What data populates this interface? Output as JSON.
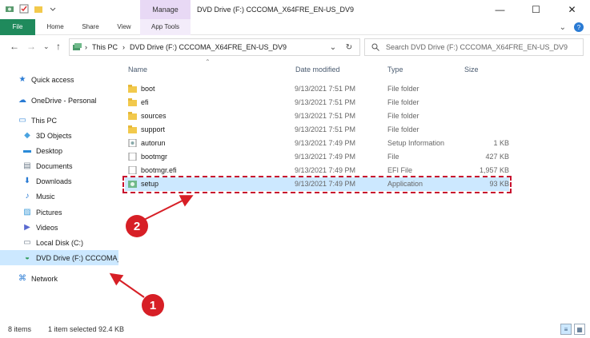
{
  "window": {
    "title": "DVD Drive (F:) CCCOMA_X64FRE_EN-US_DV9",
    "contextual_group": "Manage",
    "controls": {
      "minimize": "—",
      "maximize": "☐",
      "close": "✕"
    }
  },
  "ribbon": {
    "tabs": [
      "File",
      "Home",
      "Share",
      "View",
      "App Tools"
    ],
    "collapse_icon": "⌄",
    "help_icon": "?"
  },
  "address": {
    "breadcrumb": [
      "This PC",
      "DVD Drive (F:) CCCOMA_X64FRE_EN-US_DV9"
    ],
    "separator": "›",
    "dropdown_icon": "⌄",
    "refresh_icon": "↻",
    "search_placeholder": "Search DVD Drive (F:) CCCOMA_X64FRE_EN-US_DV9"
  },
  "navigation": {
    "back": "←",
    "forward": "→",
    "recent": "⌄",
    "up": "↑"
  },
  "sidebar": {
    "items": [
      {
        "label": "Quick access",
        "icon": "star-icon",
        "glyph": "★",
        "color": "#2a7bd4"
      },
      {
        "label": "OneDrive - Personal",
        "icon": "cloud-icon",
        "glyph": "☁",
        "color": "#2a7bd4"
      },
      {
        "label": "This PC",
        "icon": "computer-icon",
        "glyph": "▭",
        "color": "#3a8ad8"
      },
      {
        "label": "3D Objects",
        "icon": "cube-icon",
        "glyph": "◆",
        "color": "#4aa3e0"
      },
      {
        "label": "Desktop",
        "icon": "desktop-icon",
        "glyph": "▬",
        "color": "#2a8ad8"
      },
      {
        "label": "Documents",
        "icon": "documents-icon",
        "glyph": "▤",
        "color": "#6f7d8c"
      },
      {
        "label": "Downloads",
        "icon": "download-icon",
        "glyph": "⬇",
        "color": "#2a7bd4"
      },
      {
        "label": "Music",
        "icon": "music-icon",
        "glyph": "♪",
        "color": "#2a7bd4"
      },
      {
        "label": "Pictures",
        "icon": "pictures-icon",
        "glyph": "▨",
        "color": "#3a9ad8"
      },
      {
        "label": "Videos",
        "icon": "videos-icon",
        "glyph": "▶",
        "color": "#5a6ad0"
      },
      {
        "label": "Local Disk (C:)",
        "icon": "disk-icon",
        "glyph": "▭",
        "color": "#6c7a89"
      },
      {
        "label": "DVD Drive (F:) CCCOMA_X64FRE_EN-US_DV9",
        "icon": "dvd-icon",
        "glyph": "◒",
        "color": "#2f9b5a"
      },
      {
        "label": "Network",
        "icon": "network-icon",
        "glyph": "⌘",
        "color": "#2a7bd4"
      }
    ]
  },
  "columns": {
    "name": "Name",
    "date": "Date modified",
    "type": "Type",
    "size": "Size",
    "sort_arrow": "⌃"
  },
  "files": [
    {
      "name": "boot",
      "date": "9/13/2021 7:51 PM",
      "type": "File folder",
      "size": "",
      "icon": "folder-icon"
    },
    {
      "name": "efi",
      "date": "9/13/2021 7:51 PM",
      "type": "File folder",
      "size": "",
      "icon": "folder-icon"
    },
    {
      "name": "sources",
      "date": "9/13/2021 7:51 PM",
      "type": "File folder",
      "size": "",
      "icon": "folder-icon"
    },
    {
      "name": "support",
      "date": "9/13/2021 7:51 PM",
      "type": "File folder",
      "size": "",
      "icon": "folder-icon"
    },
    {
      "name": "autorun",
      "date": "9/13/2021 7:49 PM",
      "type": "Setup Information",
      "size": "1 KB",
      "icon": "setup-info-icon"
    },
    {
      "name": "bootmgr",
      "date": "9/13/2021 7:49 PM",
      "type": "File",
      "size": "427 KB",
      "icon": "file-icon"
    },
    {
      "name": "bootmgr.efi",
      "date": "9/13/2021 7:49 PM",
      "type": "EFI File",
      "size": "1,957 KB",
      "icon": "file-icon"
    },
    {
      "name": "setup",
      "date": "9/13/2021 7:49 PM",
      "type": "Application",
      "size": "93 KB",
      "icon": "setup-app-icon",
      "selected": true
    }
  ],
  "annotations": {
    "marker1": "1",
    "marker2": "2",
    "color": "#d71f26"
  },
  "status": {
    "items": "8 items",
    "selected": "1 item selected  92.4 KB"
  },
  "colors": {
    "file_tab": "#1f8a5c",
    "selection": "#cce8ff",
    "manage_tab": "#e8d9f5",
    "folder": "#f2c94c"
  }
}
